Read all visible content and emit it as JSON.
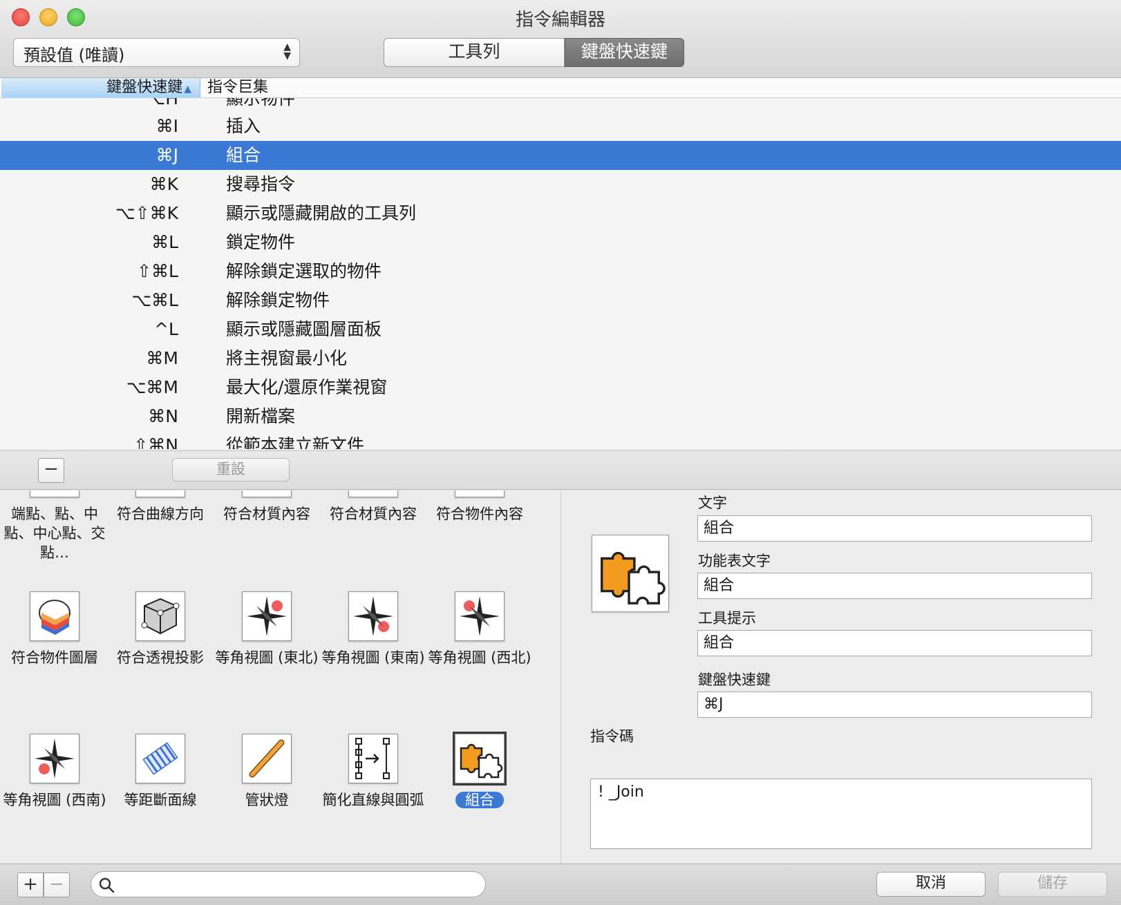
{
  "window": {
    "title": "指令編輯器"
  },
  "toolbar": {
    "preset_value": "預設值 (唯讀)",
    "tabs": [
      {
        "label": "工具列"
      },
      {
        "label": "鍵盤快速鍵",
        "selected": true
      }
    ]
  },
  "table": {
    "columns": {
      "keys": "鍵盤快速鍵",
      "macro": "指令巨集"
    },
    "rows": [
      {
        "keys": "^⌥H",
        "command": "顯示物件"
      },
      {
        "keys": "⌘I",
        "command": "插入"
      },
      {
        "keys": "⌘J",
        "command": "組合",
        "selected": true
      },
      {
        "keys": "⌘K",
        "command": "搜尋指令"
      },
      {
        "keys": "⌥⇧⌘K",
        "command": "顯示或隱藏開啟的工具列"
      },
      {
        "keys": "⌘L",
        "command": "鎖定物件"
      },
      {
        "keys": "⇧⌘L",
        "command": "解除鎖定選取的物件"
      },
      {
        "keys": "⌥⌘L",
        "command": "解除鎖定物件"
      },
      {
        "keys": "^L",
        "command": "顯示或隱藏圖層面板"
      },
      {
        "keys": "⌘M",
        "command": "將主視窗最小化"
      },
      {
        "keys": "⌥⌘M",
        "command": "最大化/還原作業視窗"
      },
      {
        "keys": "⌘N",
        "command": "開新檔案"
      },
      {
        "keys": "⇧⌘N",
        "command": "從範本建立新文件"
      }
    ]
  },
  "midbar": {
    "minus": "−",
    "reset_label": "重設"
  },
  "commands": {
    "items": [
      {
        "label": "端點、點、中點、中心點、交點…",
        "icon": "osnap-icon"
      },
      {
        "label": "符合曲線方向",
        "icon": "match-curve-direction-icon"
      },
      {
        "label": "符合材質內容",
        "icon": "match-material-icon"
      },
      {
        "label": "符合材質內容",
        "icon": "match-material-icon"
      },
      {
        "label": "符合物件內容",
        "icon": "match-properties-icon"
      },
      {
        "label": "符合物件圖層",
        "icon": "match-layer-icon"
      },
      {
        "label": "符合透視投影",
        "icon": "match-perspective-icon"
      },
      {
        "label": "等角視圖 (東北)",
        "icon": "compass-ne-icon"
      },
      {
        "label": "等角視圖 (東南)",
        "icon": "compass-se-icon"
      },
      {
        "label": "等角視圖 (西北)",
        "icon": "compass-nw-icon"
      },
      {
        "label": "等角視圖 (西南)",
        "icon": "compass-sw-icon"
      },
      {
        "label": "等距斷面線",
        "icon": "contour-icon"
      },
      {
        "label": "管狀燈",
        "icon": "tube-light-icon"
      },
      {
        "label": "簡化直線與圓弧",
        "icon": "simplify-crv-icon"
      },
      {
        "label": "組合",
        "icon": "join-puzzle-icon",
        "selected": true
      }
    ]
  },
  "properties": {
    "text_label": "文字",
    "text_value": "組合",
    "menu_text_label": "功能表文字",
    "menu_text_value": "組合",
    "tooltip_label": "工具提示",
    "tooltip_value": "組合",
    "shortcut_label": "鍵盤快速鍵",
    "shortcut_value": "⌘J",
    "macro_label": "指令碼",
    "macro_value": "! _Join",
    "icon": "join-puzzle-icon"
  },
  "bottom": {
    "add": "+",
    "remove": "−",
    "search_placeholder": "",
    "cancel_label": "取消",
    "save_label": "儲存"
  },
  "colors": {
    "selection": "#3b79d6",
    "puzzle_orange": "#f29b1f"
  }
}
